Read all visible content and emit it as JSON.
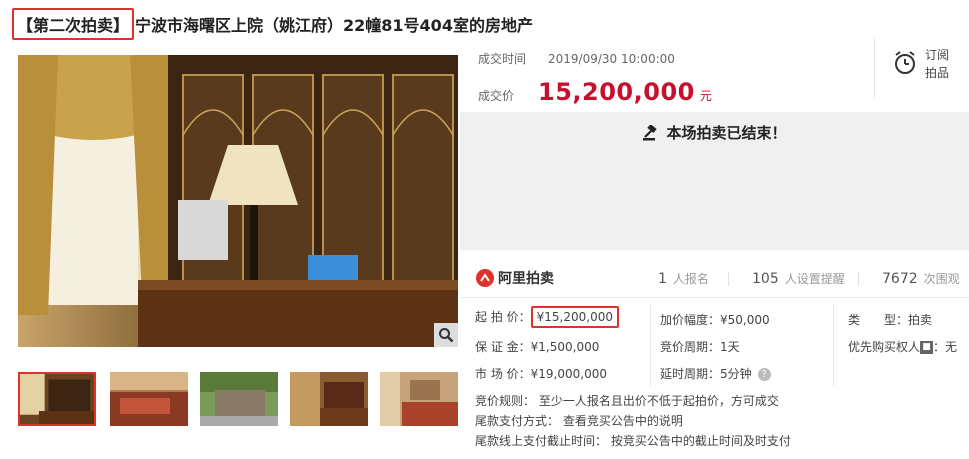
{
  "title": {
    "tag": "【第二次拍卖】",
    "text": "宁波市海曙区上院（姚江府）22幢81号404室的房地产"
  },
  "deal": {
    "time_label": "成交时间",
    "time_value": "2019/09/30 10:00:00",
    "price_label": "成交价",
    "price_value": "15,200,000",
    "price_unit": "元"
  },
  "subscribe": {
    "line1": "订阅",
    "line2": "拍品"
  },
  "status": {
    "ended_message": "本场拍卖已结束！"
  },
  "brand": {
    "name": "阿里拍卖"
  },
  "stats": [
    {
      "num": "1",
      "label": "人报名"
    },
    {
      "num": "105",
      "label": "人设置提醒"
    },
    {
      "num": "7672",
      "label": "次围观"
    }
  ],
  "info": {
    "start_price_label": "起 拍 价：",
    "start_price_value": "¥15,200,000",
    "deposit_label": "保 证 金：",
    "deposit_value": "¥1,500,000",
    "market_price_label": "市 场 价：",
    "market_price_value": "¥19,000,000",
    "increment_label": "加价幅度：",
    "increment_value": "¥50,000",
    "bid_cycle_label": "竞价周期：",
    "bid_cycle_value": "1天",
    "delay_cycle_label": "延时周期：",
    "delay_cycle_value": "5分钟",
    "type_label": "类　　型：",
    "type_value": "拍卖",
    "priority_label": "优先购买权人",
    "priority_badge": "■",
    "priority_value": "：无"
  },
  "rules": [
    "竞价规则：   至少一人报名且出价不低于起拍价，方可成交",
    "尾款支付方式：   查看竞买公告中的说明",
    "尾款线上支付截止时间：   按竞买公告中的截止时间及时支付"
  ],
  "colors": {
    "accent": "#c8102e",
    "highlight_border": "#e0312a"
  },
  "icons": {
    "zoom": "magnifier-icon",
    "clock": "alarm-clock-icon",
    "gavel": "gavel-icon",
    "help": "question-circle-icon"
  }
}
